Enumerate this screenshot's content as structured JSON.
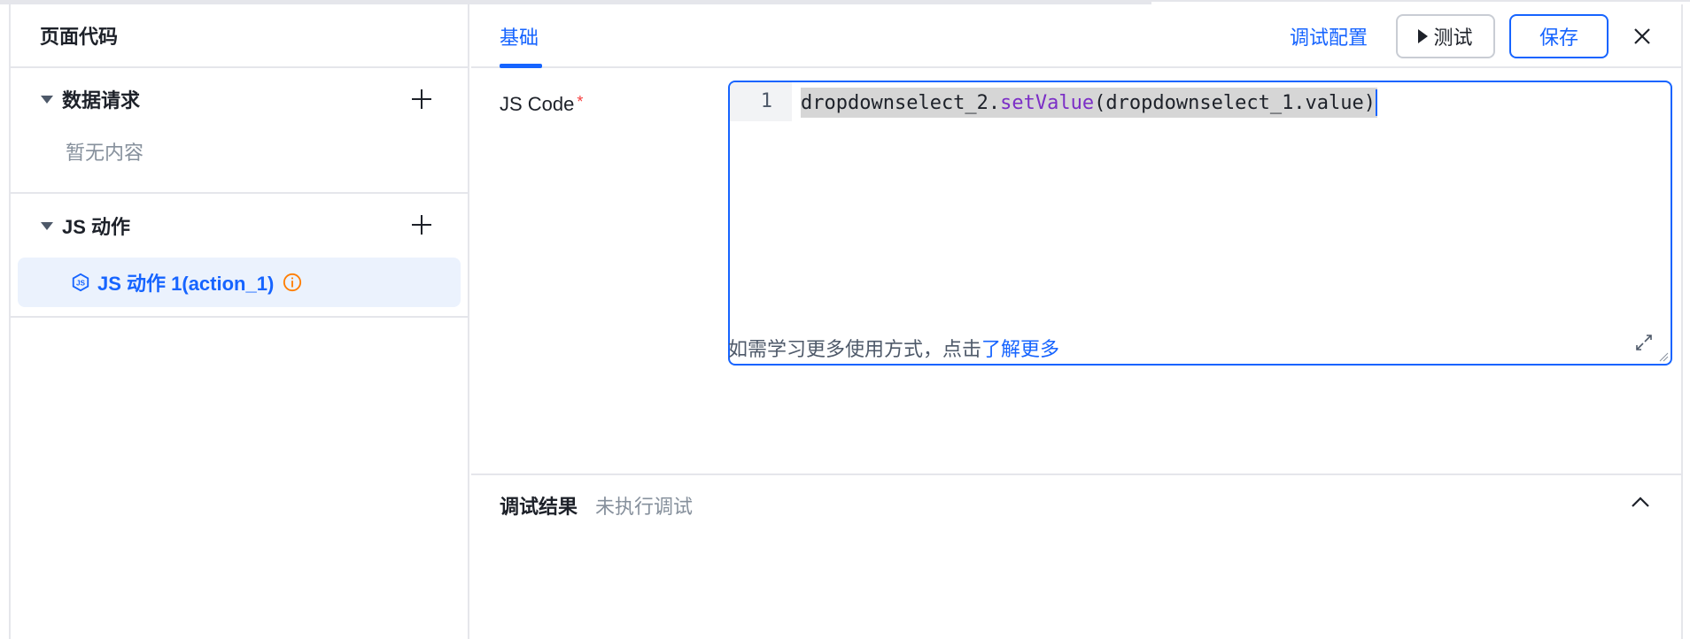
{
  "left": {
    "title": "页面代码",
    "data_requests": {
      "label": "数据请求",
      "empty_text": "暂无内容"
    },
    "js_actions": {
      "label": "JS 动作",
      "items": [
        {
          "label": "JS 动作 1(action_1)",
          "icon": "js-hex-icon",
          "status_icon": "info-icon"
        }
      ]
    }
  },
  "right": {
    "tabs": [
      {
        "label": "基础",
        "active": true
      }
    ],
    "toolbar": {
      "debug_config_label": "调试配置",
      "test_label": "测试",
      "save_label": "保存"
    },
    "form": {
      "js_code_label": "JS Code",
      "required_mark": "*",
      "editor": {
        "line_number": "1",
        "code_prefix": "dropdownselect_2.",
        "code_method": "setValue",
        "code_suffix": "(dropdownselect_1.value)"
      },
      "hint_text": "如需学习更多使用方式，点击",
      "hint_link": "了解更多"
    },
    "debug_result": {
      "title": "调试结果",
      "status": "未执行调试"
    }
  },
  "colors": {
    "accent": "#1664ff",
    "required": "#f53f3f",
    "warning": "#ff7d00",
    "border": "#e5e6eb"
  }
}
